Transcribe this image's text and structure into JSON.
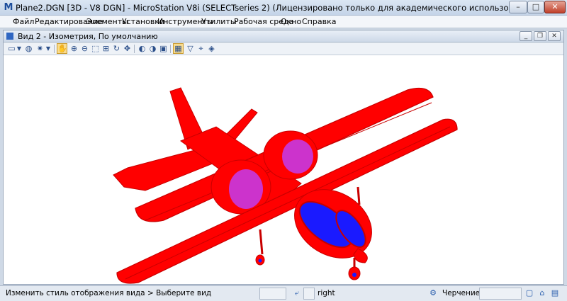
{
  "window": {
    "title": "Plane2.DGN [3D - V8 DGN] - MicroStation V8i (SELECTseries 2) (Лицензировано только для академического использования)",
    "app_icon": "M",
    "controls": {
      "minimize": "–",
      "maximize": "□",
      "close": "✕"
    }
  },
  "menu": {
    "items": [
      {
        "label": "Файл"
      },
      {
        "label": "Редактирование"
      },
      {
        "label": "Элементы"
      },
      {
        "label": "Установки"
      },
      {
        "label": "Инструменты"
      },
      {
        "label": "Утилиты"
      },
      {
        "label": "Рабочая среда"
      },
      {
        "label": "Окно"
      },
      {
        "label": "Справка"
      }
    ]
  },
  "view": {
    "title": "Вид 2 - Изометрия, По умолчанию",
    "toolbar_icons": [
      "view-attributes-icon",
      "dropdown-arrow-icon",
      "display-style-icon",
      "lights-icon",
      "dropdown-arrow-icon",
      "update-view-icon",
      "zoom-in-icon",
      "zoom-out-icon",
      "window-area-icon",
      "fit-view-icon",
      "rotate-view-icon",
      "pan-view-icon",
      "previous-view-icon",
      "next-view-icon",
      "copy-view-icon",
      "view-display-mode-icon",
      "clip-volume-icon",
      "camera-icon",
      "render-icon"
    ],
    "model": {
      "colors": {
        "body": "#ff0000",
        "body_dark": "#c80000",
        "canopy": "#1a1aff",
        "fairing": "#cc33cc"
      }
    }
  },
  "status": {
    "prompt": "Изменить стиль отображения вида > Выберите вид",
    "snap_text": "right",
    "level_text": "Черчение"
  }
}
